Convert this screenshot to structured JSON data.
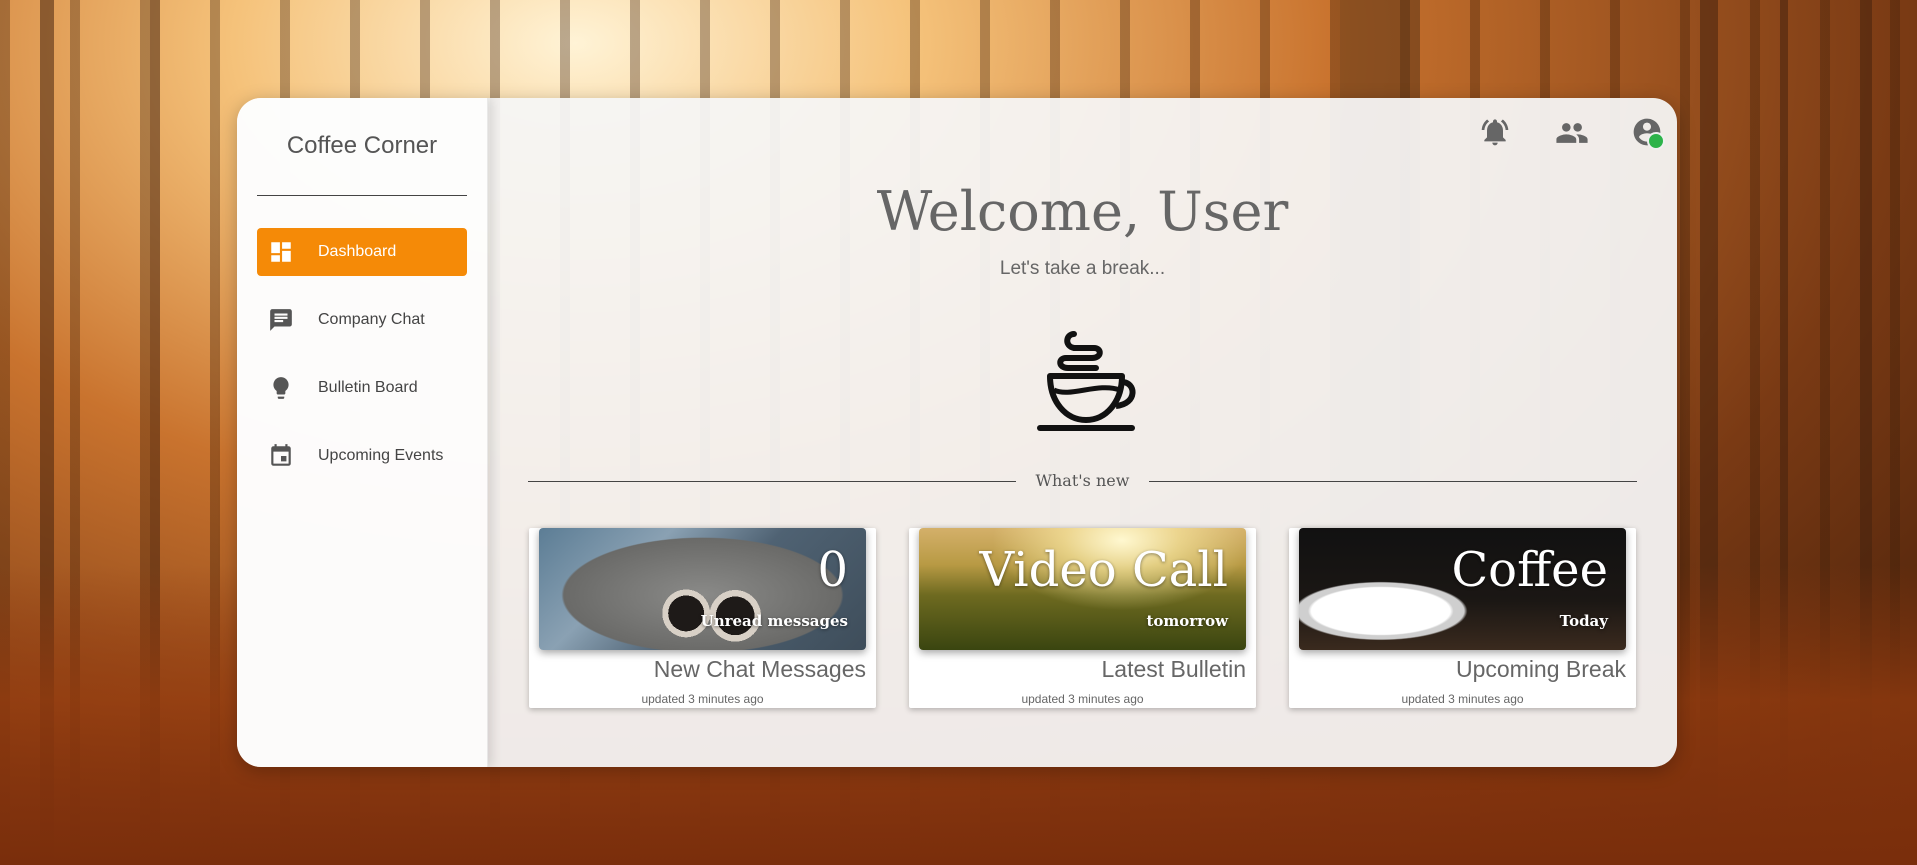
{
  "sidebar": {
    "brand": "Coffee Corner",
    "items": [
      {
        "label": "Dashboard",
        "icon": "dashboard-icon",
        "active": true
      },
      {
        "label": "Company Chat",
        "icon": "chat-icon",
        "active": false
      },
      {
        "label": "Bulletin Board",
        "icon": "lightbulb-icon",
        "active": false
      },
      {
        "label": "Upcoming Events",
        "icon": "calendar-icon",
        "active": false
      }
    ]
  },
  "header": {
    "icons": [
      "notifications-icon",
      "people-icon",
      "account-icon"
    ],
    "account_status": "online"
  },
  "main": {
    "title": "Welcome, User",
    "subtitle": "Let's take a break...",
    "hero_icon": "coffee-cup-icon",
    "section_label": "What's new",
    "cards": [
      {
        "big": "0",
        "small": "Unread messages",
        "title": "New Chat Messages",
        "updated": "updated 3 minutes ago"
      },
      {
        "big": "Video Call",
        "small": "tomorrow",
        "title": "Latest Bulletin",
        "updated": "updated 3 minutes ago"
      },
      {
        "big": "Coffee",
        "small": "Today",
        "title": "Upcoming Break",
        "updated": "updated 3 minutes ago"
      }
    ]
  },
  "colors": {
    "accent": "#f58a07",
    "online": "#2db34a",
    "text": "#666666"
  }
}
